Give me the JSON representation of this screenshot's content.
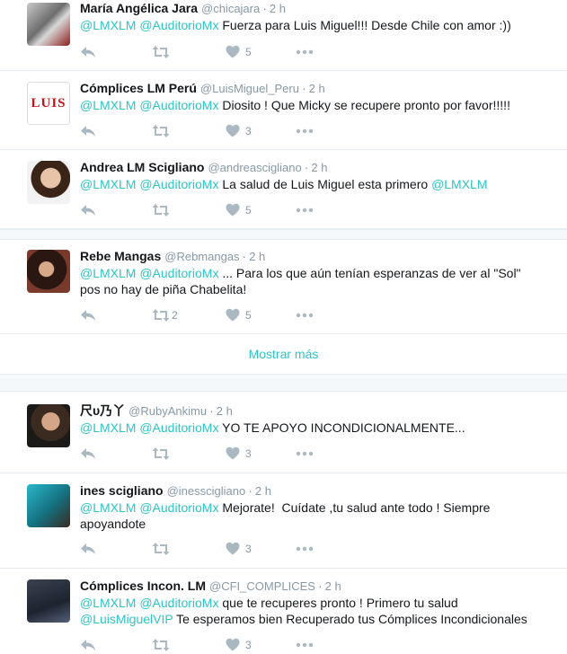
{
  "colors": {
    "accent": "#2bc5c6",
    "muted": "#8899a6",
    "divider": "#e6ecf0"
  },
  "tweets": [
    {
      "name": "María Angélica Jara",
      "handle": "@chicajara",
      "time": "2 h",
      "m1": "@LMXLM",
      "m2": "@AuditorioMx",
      "text": " Fuerza para Luis Miguel!!! Desde Chile con amor :))",
      "likes": "5",
      "retweets": ""
    },
    {
      "name": "Cómplices LM Perú",
      "handle": "@LuisMiguel_Peru",
      "time": "2 h",
      "m1": "@LMXLM",
      "m2": "@AuditorioMx",
      "text": " Diosito ! Que Micky se recupere pronto por favor!!!!!",
      "likes": "3",
      "retweets": "",
      "avatar_text": "LUIS"
    },
    {
      "name": "Andrea LM Scigliano",
      "handle": "@andreascigliano",
      "time": "2 h",
      "m1": "@LMXLM",
      "m2": "@AuditorioMx",
      "text": " La salud de Luis Miguel esta primero ",
      "m3": "@LMXLM",
      "likes": "5",
      "retweets": ""
    },
    {
      "name": "Rebe Mangas",
      "handle": "@Rebmangas",
      "time": "2 h",
      "m1": "@LMXLM",
      "m2": "@AuditorioMx",
      "text": " ... Para los que aún tenían esperanzas de ver al \"Sol\"\npos no hay de piña Chabelita!",
      "likes": "5",
      "retweets": "2"
    },
    {
      "name": "尺υ乃丫",
      "handle": "@RubyAnkimu",
      "time": "2 h",
      "m1": "@LMXLM",
      "m2": "@AuditorioMx",
      "text": " YO TE APOYO INCONDICIONALMENTE...",
      "likes": "3",
      "retweets": ""
    },
    {
      "name": "ines scigliano",
      "handle": "@inesscigliano",
      "time": "2 h",
      "m1": "@LMXLM",
      "m2": "@AuditorioMx",
      "text": " Mejorate!  Cuídate ,tu salud ante todo ! Siempre\napoyandote",
      "likes": "3",
      "retweets": ""
    },
    {
      "name": "Cómplices Incon. LM",
      "handle": "@CFI_COMPLICES",
      "time": "2 h",
      "m1": "@LMXLM",
      "m2": "@AuditorioMx",
      "text": " que te recuperes pronto ! Primero tu salud",
      "m3": "@LuisMiguelVIP",
      "text2": " Te esperamos bien Recuperado tus Cómplices Incondicionales",
      "likes": "3",
      "retweets": ""
    }
  ],
  "show_more": "Mostrar más",
  "icons": [
    "reply-icon",
    "retweet-icon",
    "like-icon",
    "more-icon"
  ]
}
